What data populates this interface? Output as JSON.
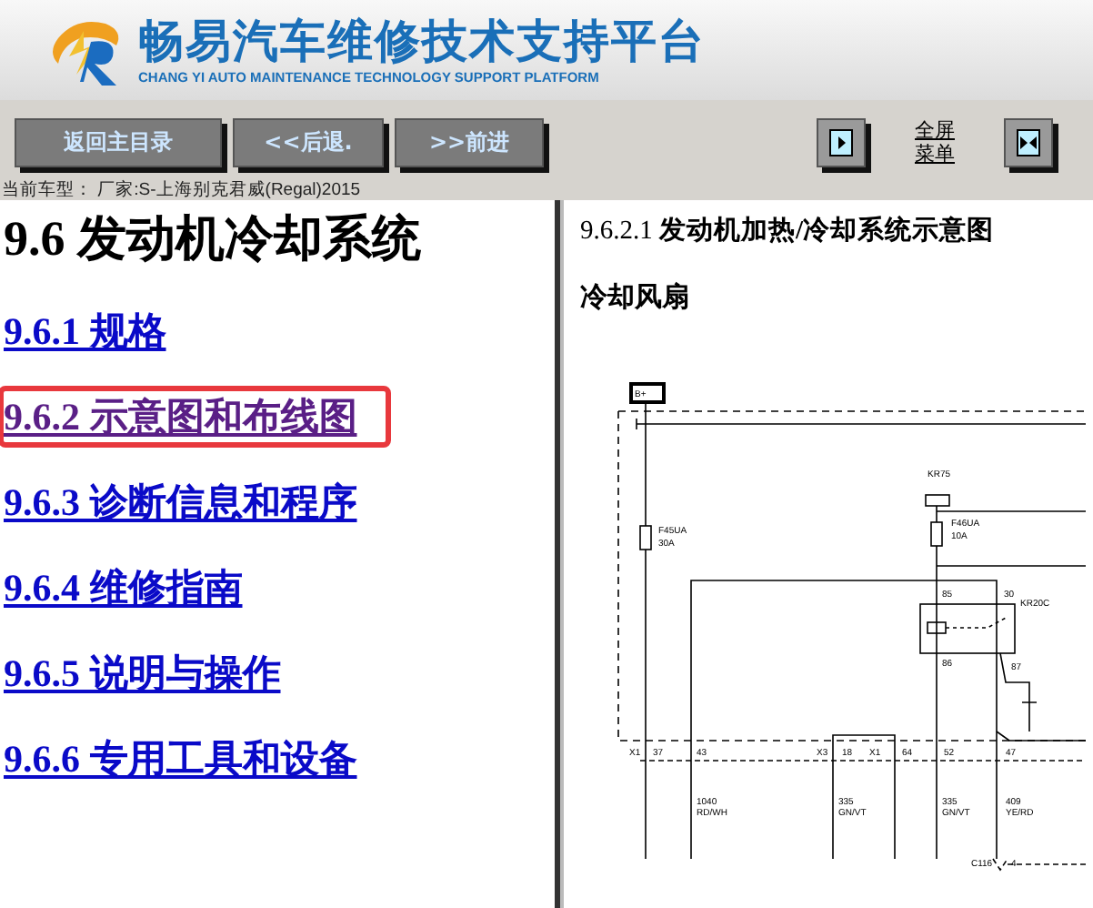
{
  "header": {
    "title": "畅易汽车维修技术支持平台",
    "subtitle": "CHANG YI AUTO MAINTENANCE TECHNOLOGY SUPPORT PLATFORM"
  },
  "toolbar": {
    "buttons": [
      "返回主目录",
      "<<后退.",
      ">>前进"
    ],
    "fullscreen_link": "全屏菜单"
  },
  "current_model": "当前车型：  厂家:S-上海别克君威(Regal)2015",
  "left_pane": {
    "title": "9.6 发动机冷却系统",
    "links": [
      {
        "label": "9.6.1 规格",
        "visited": false,
        "highlighted": false
      },
      {
        "label": "9.6.2 示意图和布线图",
        "visited": true,
        "highlighted": true
      },
      {
        "label": "9.6.3 诊断信息和程序",
        "visited": false,
        "highlighted": false
      },
      {
        "label": "9.6.4 维修指南",
        "visited": false,
        "highlighted": false
      },
      {
        "label": "9.6.5 说明与操作",
        "visited": false,
        "highlighted": false
      },
      {
        "label": "9.6.6 专用工具和设备",
        "visited": false,
        "highlighted": false
      }
    ]
  },
  "right_pane": {
    "heading": "9.6.2.1 **发动机加热/冷却系统示意图**",
    "subheading": "冷却风扇",
    "diagram_labels": [
      "B+",
      "F45UA",
      "30A",
      "KR75",
      "F46UA",
      "10A",
      "85",
      "30",
      "KR20C",
      "86",
      "87",
      "X1",
      "37",
      "43",
      "X3",
      "18",
      "X1",
      "64",
      "52",
      "47",
      "1040",
      "RD/WH",
      "335",
      "GN/VT",
      "335",
      "GN/VT",
      "409",
      "YE/RD",
      "C116",
      "4"
    ]
  }
}
